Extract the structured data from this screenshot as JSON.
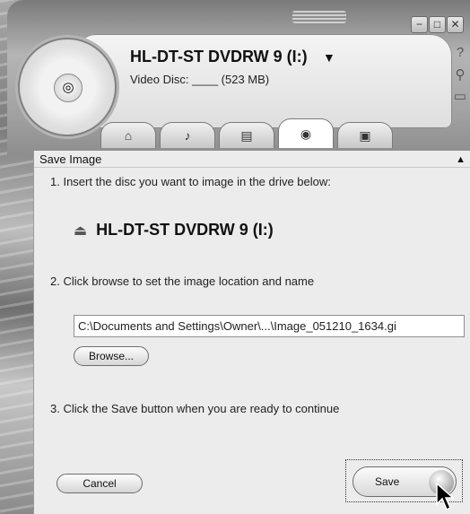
{
  "window": {
    "minimize_glyph": "−",
    "maximize_glyph": "□",
    "close_glyph": "✕"
  },
  "header": {
    "drive_name": "HL-DT-ST DVDRW 9 (I:)",
    "dropdown_glyph": "▼",
    "disc_info": "Video Disc: ____ (523 MB)"
  },
  "side_icons": [
    "help-icon",
    "search-icon",
    "folder-icon"
  ],
  "tabs": [
    {
      "name": "home",
      "icon": "home-icon"
    },
    {
      "name": "music",
      "icon": "music-icon"
    },
    {
      "name": "photo",
      "icon": "photo-icon"
    },
    {
      "name": "copy",
      "icon": "disc-copy-icon",
      "active": true
    },
    {
      "name": "video",
      "icon": "video-icon"
    }
  ],
  "panel": {
    "title": "Save Image",
    "step1": "1. Insert the disc you want to image in the drive below:",
    "drive_name": "HL-DT-ST DVDRW 9 (I:)",
    "step2": "2. Click browse to set the image location and name",
    "path_value": "C:\\Documents and Settings\\Owner\\...\\Image_051210_1634.gi",
    "browse_label": "Browse...",
    "step3": "3. Click the Save button when you are ready to continue",
    "cancel_label": "Cancel",
    "save_label": "Save"
  }
}
